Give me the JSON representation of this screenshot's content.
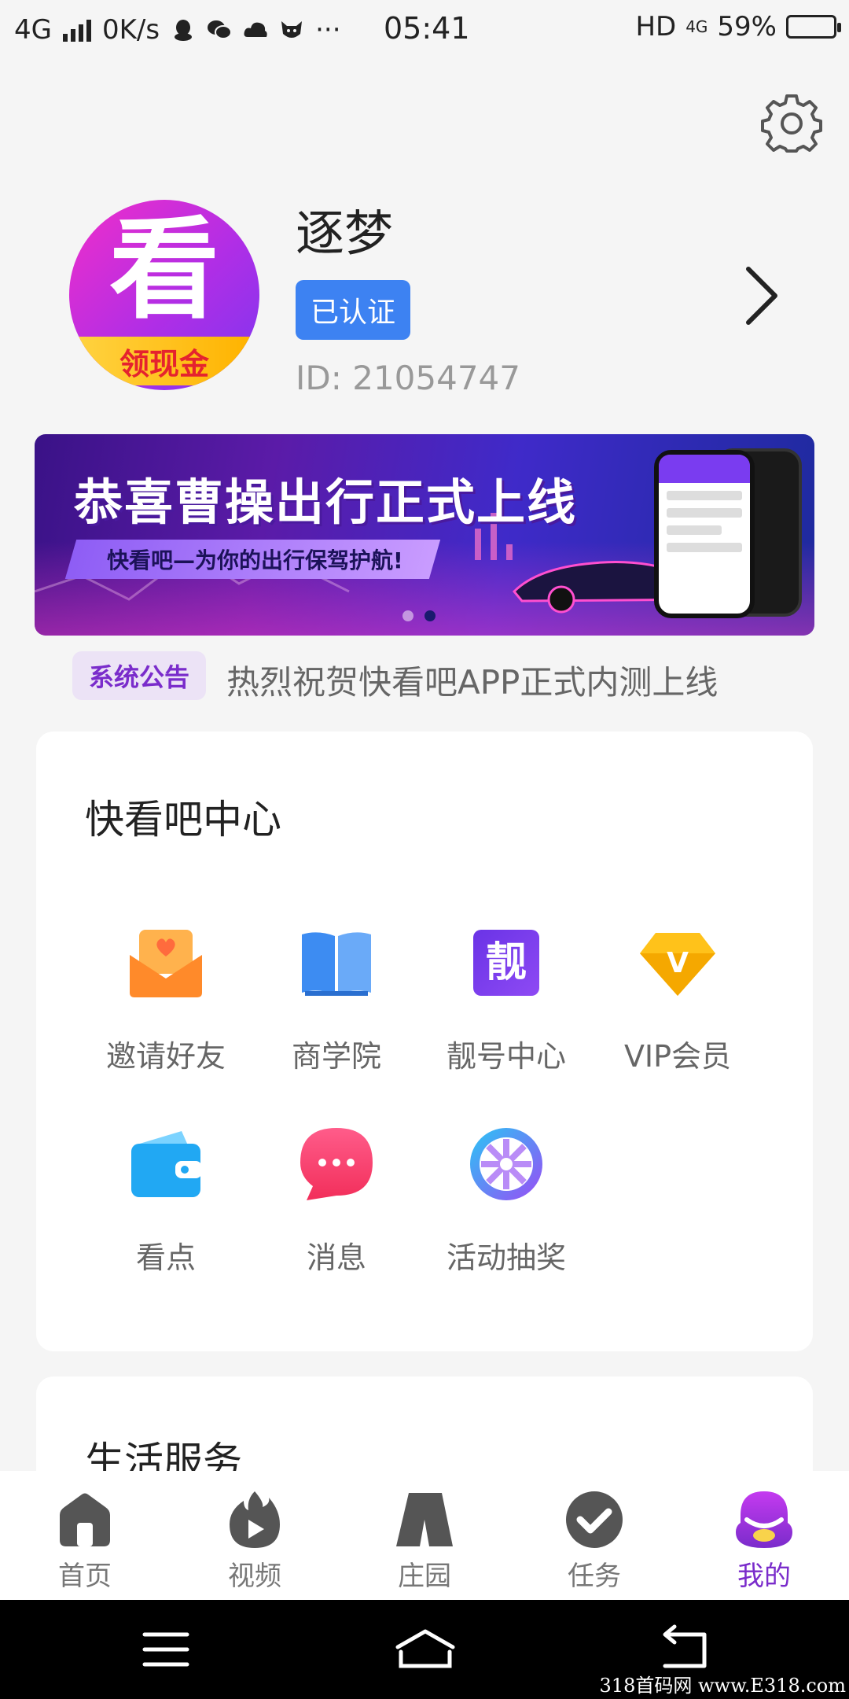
{
  "status_bar": {
    "network": "4G",
    "speed": "0K/s",
    "more": "···",
    "time": "05:41",
    "hd": "HD",
    "network_right": "4G",
    "battery": "59%",
    "battery_level": 0.59
  },
  "profile": {
    "avatar_glyph": "看",
    "avatar_ribbon": "领现金",
    "username": "逐梦",
    "verified_badge": "已认证",
    "user_id": "ID: 21054747"
  },
  "banner": {
    "title": "恭喜曹操出行正式上线",
    "subtitle": "快看吧—为你的出行保驾护航!",
    "slide_count": 2,
    "active_slide": 1
  },
  "notice": {
    "tag": "系统公告",
    "text": "热烈祝贺快看吧APP正式内测上线"
  },
  "center": {
    "title": "快看吧中心",
    "items": [
      {
        "label": "邀请好友",
        "icon": "envelope-heart-icon"
      },
      {
        "label": "商学院",
        "icon": "book-icon"
      },
      {
        "label": "靓号中心",
        "icon": "liang-badge-icon",
        "glyph": "靓"
      },
      {
        "label": "VIP会员",
        "icon": "vip-diamond-icon",
        "glyph": "V"
      },
      {
        "label": "看点",
        "icon": "wallet-icon"
      },
      {
        "label": "消息",
        "icon": "chat-bubble-icon"
      },
      {
        "label": "活动抽奖",
        "icon": "lottery-wheel-icon"
      }
    ]
  },
  "life": {
    "title": "生活服务"
  },
  "tabs": [
    {
      "label": "首页",
      "icon": "home-icon"
    },
    {
      "label": "视频",
      "icon": "video-flame-icon"
    },
    {
      "label": "庄园",
      "icon": "manor-icon"
    },
    {
      "label": "任务",
      "icon": "task-check-icon"
    },
    {
      "label": "我的",
      "icon": "profile-icon",
      "active": true
    }
  ],
  "watermark": "318首码网  www.E318.com",
  "colors": {
    "accent_purple": "#7a2ccb",
    "verified_blue": "#3d82f2",
    "page_bg": "#f5f5f5"
  }
}
